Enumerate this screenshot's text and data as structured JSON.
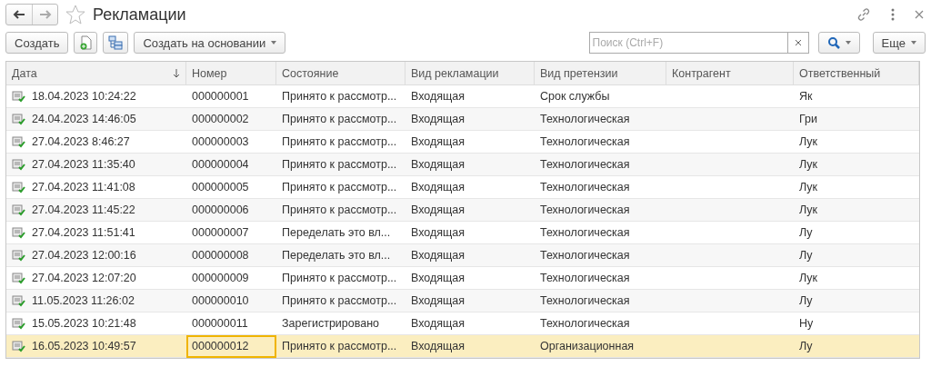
{
  "window": {
    "title": "Рекламации",
    "favorite": false
  },
  "toolbar": {
    "create": "Создать",
    "create_based": "Создать на основании",
    "search": {
      "placeholder": "Поиск (Ctrl+F)"
    },
    "more": "Еще"
  },
  "table": {
    "columns": [
      {
        "label": "Дата",
        "sorted": true
      },
      {
        "label": "Номер",
        "sorted": false
      },
      {
        "label": "Состояние",
        "sorted": false
      },
      {
        "label": "Вид рекламации",
        "sorted": false
      },
      {
        "label": "Вид претензии",
        "sorted": false
      },
      {
        "label": "Контрагент",
        "sorted": false
      },
      {
        "label": "Ответственный",
        "sorted": false
      }
    ],
    "rows": [
      {
        "date": "18.04.2023 10:24:22",
        "number": "000000001",
        "state": "Принято к рассмотр...",
        "type": "Входящая",
        "claim": "Срок службы",
        "responsible": "Як",
        "selected": false
      },
      {
        "date": "24.04.2023 14:46:05",
        "number": "000000002",
        "state": "Принято к рассмотр...",
        "type": "Входящая",
        "claim": "Технологическая",
        "responsible": "Гри",
        "selected": false
      },
      {
        "date": "27.04.2023 8:46:27",
        "number": "000000003",
        "state": "Принято к рассмотр...",
        "type": "Входящая",
        "claim": "Технологическая",
        "responsible": "Лук",
        "selected": false
      },
      {
        "date": "27.04.2023 11:35:40",
        "number": "000000004",
        "state": "Принято к рассмотр...",
        "type": "Входящая",
        "claim": "Технологическая",
        "responsible": "Лук",
        "selected": false
      },
      {
        "date": "27.04.2023 11:41:08",
        "number": "000000005",
        "state": "Принято к рассмотр...",
        "type": "Входящая",
        "claim": "Технологическая",
        "responsible": "Лук",
        "selected": false
      },
      {
        "date": "27.04.2023 11:45:22",
        "number": "000000006",
        "state": "Принято к рассмотр...",
        "type": "Входящая",
        "claim": "Технологическая",
        "responsible": "Лук",
        "selected": false
      },
      {
        "date": "27.04.2023 11:51:41",
        "number": "000000007",
        "state": "Переделать это вл...",
        "type": "Входящая",
        "claim": "Технологическая",
        "responsible": "Лу",
        "selected": false
      },
      {
        "date": "27.04.2023 12:00:16",
        "number": "000000008",
        "state": "Переделать это вл...",
        "type": "Входящая",
        "claim": "Технологическая",
        "responsible": "Лу",
        "selected": false
      },
      {
        "date": "27.04.2023 12:07:20",
        "number": "000000009",
        "state": "Принято к рассмотр...",
        "type": "Входящая",
        "claim": "Технологическая",
        "responsible": "Лук",
        "selected": false
      },
      {
        "date": "11.05.2023 11:26:02",
        "number": "000000010",
        "state": "Принято к рассмотр...",
        "type": "Входящая",
        "claim": "Технологическая",
        "responsible": "Лу",
        "selected": false
      },
      {
        "date": "15.05.2023 10:21:48",
        "number": "000000011",
        "state": "Зарегистрировано",
        "type": "Входящая",
        "claim": "Технологическая",
        "responsible": "Ну",
        "selected": false
      },
      {
        "date": "16.05.2023 10:49:57",
        "number": "000000012",
        "state": "Принято к рассмотр...",
        "type": "Входящая",
        "claim": "Организационная",
        "responsible": "Лу",
        "selected": true
      }
    ]
  }
}
